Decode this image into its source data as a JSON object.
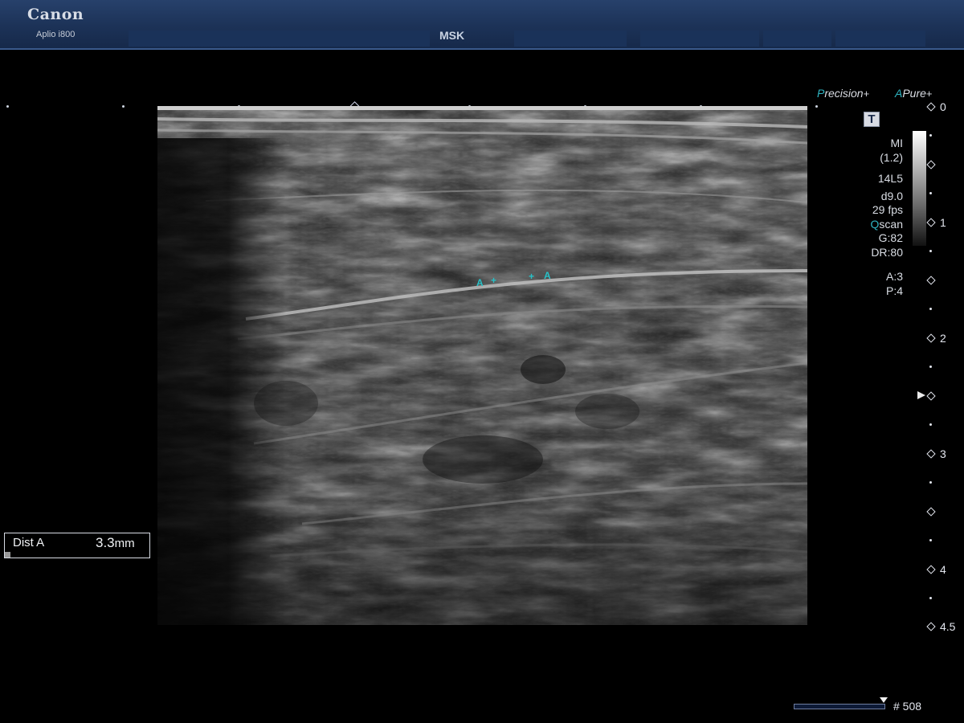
{
  "header": {
    "brand": "Canon",
    "model": "Aplio i800",
    "exam_preset": "MSK"
  },
  "image_tags": {
    "precision": {
      "initial": "P",
      "rest": "recision",
      "plus": "+"
    },
    "apure": {
      "initial": "A",
      "rest": "Pure",
      "plus": "+"
    },
    "t_button": "T"
  },
  "parameters": {
    "mi_label": "MI",
    "mi_value": "(1.2)",
    "probe": "14L5",
    "depth_setting": "d9.0",
    "frame_rate": "29 fps",
    "qscan_q": "Q",
    "qscan_rest": "scan",
    "gain": "G:82",
    "dynamic_range": "DR:80",
    "a_param": "A:3",
    "p_param": "P:4"
  },
  "depth_scale": {
    "labels": [
      "0",
      "1",
      "2",
      "3",
      "4",
      "4.5"
    ],
    "focus_depth_cm": 2.5
  },
  "measurement": {
    "caliper_a_label": "A",
    "caliper_cross": "+",
    "label": "Dist A",
    "value": "3.3",
    "unit": "mm"
  },
  "cine": {
    "frame_counter": "# 508"
  },
  "colors": {
    "caliper": "#28c1c7",
    "header": "#1c3257",
    "accent_cyan": "#2fb4c1"
  }
}
